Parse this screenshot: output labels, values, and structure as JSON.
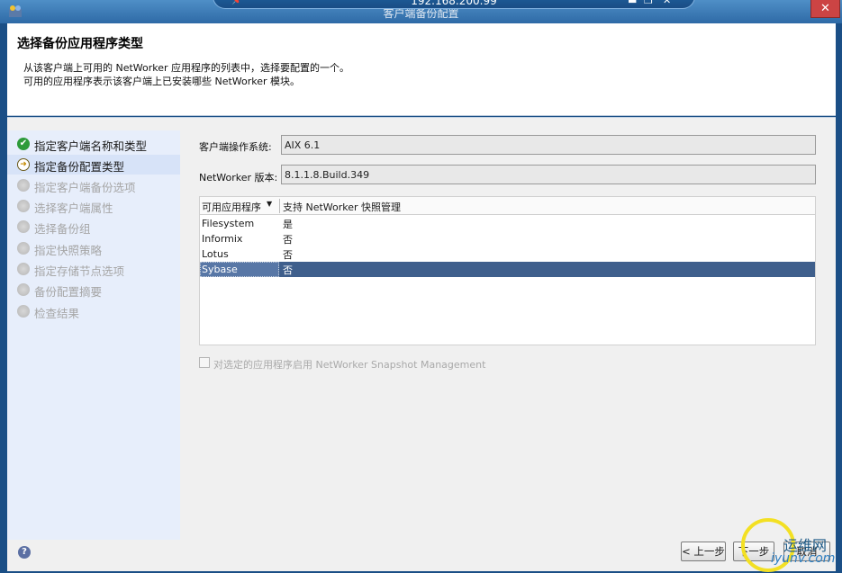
{
  "window": {
    "title": "客户端备份配置",
    "rdp_address": "192.168.200.99",
    "close_symbol": "✕"
  },
  "header": {
    "title": "选择备份应用程序类型",
    "desc_line1": "从该客户端上可用的 NetWorker 应用程序的列表中，选择要配置的一个。",
    "desc_line2": "可用的应用程序表示该客户端上已安装哪些 NetWorker 模块。"
  },
  "steps": [
    {
      "label": "指定客户端名称和类型",
      "state": "done"
    },
    {
      "label": "指定备份配置类型",
      "state": "current"
    },
    {
      "label": "指定客户端备份选项",
      "state": "pending"
    },
    {
      "label": "选择客户端属性",
      "state": "pending"
    },
    {
      "label": "选择备份组",
      "state": "pending"
    },
    {
      "label": "指定快照策略",
      "state": "pending"
    },
    {
      "label": "指定存储节点选项",
      "state": "pending"
    },
    {
      "label": "备份配置摘要",
      "state": "pending"
    },
    {
      "label": "检查结果",
      "state": "pending"
    }
  ],
  "fields": {
    "os_label": "客户端操作系统:",
    "os_value": "AIX 6.1",
    "version_label": "NetWorker 版本:",
    "version_value": "8.1.1.8.Build.349"
  },
  "table": {
    "headers": [
      "可用应用程序",
      "支持 NetWorker 快照管理"
    ],
    "rows": [
      {
        "app": "Filesystem",
        "snapshot": "是"
      },
      {
        "app": "Informix",
        "snapshot": "否"
      },
      {
        "app": "Lotus",
        "snapshot": "否"
      },
      {
        "app": "Sybase",
        "snapshot": "否"
      }
    ],
    "selected_row": 3
  },
  "snapshot_checkbox": {
    "label": "对选定的应用程序启用 NetWorker Snapshot Management",
    "checked": false,
    "enabled": false
  },
  "buttons": {
    "back": "< 上一步",
    "next": "下一步",
    "cancel": "取消"
  },
  "help_symbol": "?",
  "watermark": {
    "line1": "运维网",
    "line2": "iyunv.com"
  },
  "colors": {
    "selection": "#3f5f8c",
    "step_done": "#2e9b3a",
    "nav_background": "#e7eefb",
    "highlight_ring": "#f3e023"
  }
}
